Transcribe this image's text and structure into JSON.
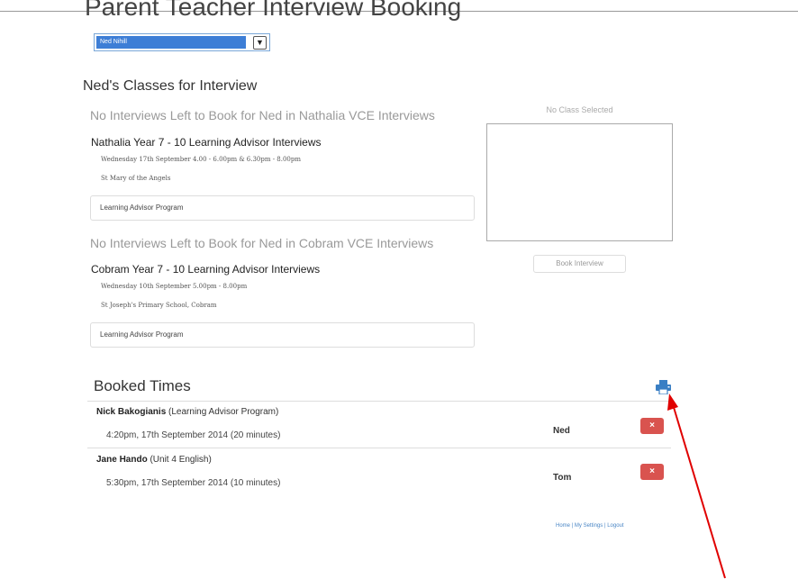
{
  "page": {
    "title": "Parent Teacher Interview Booking",
    "student_select": "Ned Nihill"
  },
  "classes": {
    "heading": "Ned's Classes for Interview",
    "groups": [
      {
        "notice": "No Interviews Left to Book for Ned in Nathalia VCE Interviews",
        "title": "Nathalia Year 7 - 10 Learning Advisor Interviews",
        "date": "Wednesday 17th September 4.00 - 6.00pm & 6.30pm - 8.00pm",
        "location": "St Mary of the Angels",
        "subject": "Learning Advisor Program"
      },
      {
        "notice": "No Interviews Left to Book for Ned in Cobram VCE Interviews",
        "title": "Cobram Year 7 - 10 Learning Advisor Interviews",
        "date": "Wednesday 10th September 5.00pm - 8.00pm",
        "location": "St Joseph's Primary School, Cobram",
        "subject": "Learning Advisor Program"
      }
    ]
  },
  "side_panel": {
    "no_class": "No Class Selected",
    "book_button": "Book Interview"
  },
  "booked": {
    "heading": "Booked Times",
    "print_icon": "printer-icon",
    "rows": [
      {
        "teacher": "Nick Bakogianis",
        "subject": " (Learning Advisor Program)",
        "time": "4:20pm, 17th September 2014 (20 minutes)",
        "child": "Ned",
        "delete": "×"
      },
      {
        "teacher": "Jane Hando",
        "subject": " (Unit 4 English)",
        "time": "5:30pm, 17th September 2014 (10 minutes)",
        "child": "Tom",
        "delete": "×"
      }
    ]
  },
  "footer": {
    "home": "Home",
    "sep1": " | ",
    "settings": "My Settings",
    "sep2": " | ",
    "logout": "Logout"
  },
  "colors": {
    "delete": "#d9534f",
    "link": "#4a86c5",
    "annotation_arrow": "#e00000",
    "printer": "#3a7fc4"
  }
}
